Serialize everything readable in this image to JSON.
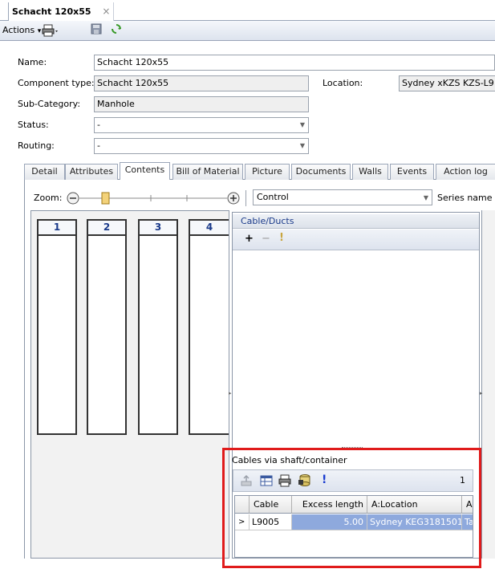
{
  "doc_tab": {
    "title": "Schacht 120x55",
    "close": "×"
  },
  "toolbar": {
    "actions": "Actions",
    "dropdown": "▾"
  },
  "form": {
    "name_label": "Name:",
    "name_value": "Schacht 120x55",
    "type_label": "Component type:",
    "type_value": "Schacht 120x55",
    "location_label": "Location:",
    "location_value": "Sydney xKZS KZS-L9",
    "subcat_label": "Sub-Category:",
    "subcat_value": "Manhole",
    "status_label": "Status:",
    "status_value": "-",
    "routing_label": "Routing:",
    "routing_value": "-"
  },
  "tabs": [
    "Detail",
    "Attributes",
    "Contents",
    "Bill of Material",
    "Picture",
    "Documents",
    "Walls",
    "Events",
    "Action log"
  ],
  "contents": {
    "zoom_label": "Zoom:",
    "control_value": "Control",
    "series_label": "Series name",
    "columns": [
      "1",
      "2",
      "3",
      "4"
    ],
    "cable_ducts_title": "Cable/Ducts",
    "ducts_tools": {
      "add": "+",
      "remove": "−",
      "alert": "!"
    }
  },
  "cables_via": {
    "title": "Cables via shaft/container",
    "count": "1",
    "alert": "!",
    "headers": [
      "Cable",
      "Excess length",
      "A:Location",
      "A"
    ],
    "rows": [
      {
        "cable": "L9005",
        "excess": "5.00",
        "location": "Sydney KEG3181501",
        "a": "Ta"
      }
    ]
  }
}
